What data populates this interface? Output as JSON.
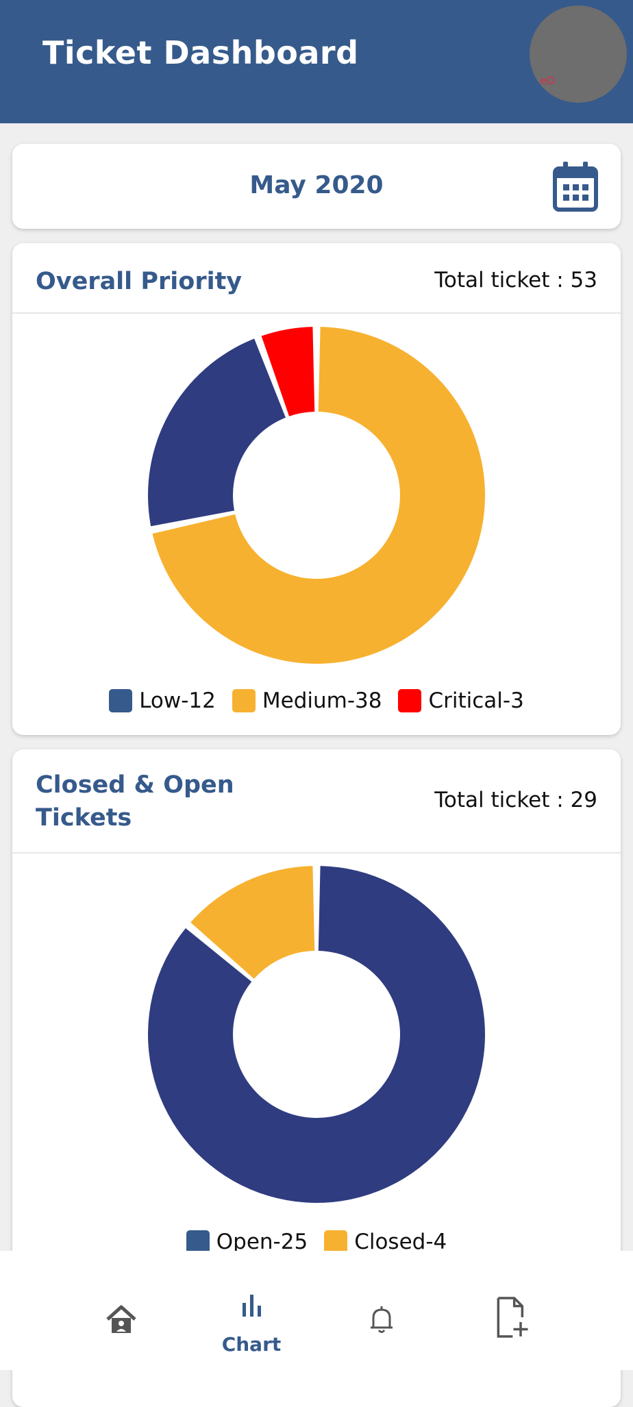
{
  "header": {
    "title": "Ticket Dashboard",
    "avatar_text": "eO"
  },
  "month": {
    "label": "May 2020",
    "calendar_icon": "calendar-icon"
  },
  "colors": {
    "primary": "#365a8b",
    "navy": "#303c80",
    "amber": "#f7b130",
    "red": "#ff0000"
  },
  "priority": {
    "title": "Overall Priority",
    "total": "Total ticket : 53"
  },
  "status": {
    "title_line1": "Closed & Open",
    "title_line2": "Tickets",
    "total": "Total ticket : 29"
  },
  "nav": {
    "items": [
      {
        "icon": "home-icon",
        "label": ""
      },
      {
        "icon": "chart-icon",
        "label": "Chart"
      },
      {
        "icon": "bell-icon",
        "label": ""
      },
      {
        "icon": "add-file-icon",
        "label": ""
      }
    ]
  },
  "chart_data": [
    {
      "type": "pie",
      "categories": [
        "Low-12",
        "Medium-38",
        "Critical-3"
      ],
      "values": [
        12,
        38,
        3
      ],
      "colors": [
        "#303c80",
        "#f7b130",
        "#ff0000"
      ],
      "legend_colors": [
        "#365a8b",
        "#f7b130",
        "#ff0000"
      ],
      "order": [
        "Medium-38",
        "Low-12",
        "Critical-3"
      ],
      "legend": "bottom"
    },
    {
      "type": "pie",
      "categories": [
        "Open-25",
        "Closed-4"
      ],
      "values": [
        25,
        4
      ],
      "colors": [
        "#303c80",
        "#f7b130"
      ],
      "legend_colors": [
        "#365a8b",
        "#f7b130"
      ],
      "order": [
        "Open-25",
        "Closed-4"
      ],
      "legend": "bottom"
    }
  ]
}
